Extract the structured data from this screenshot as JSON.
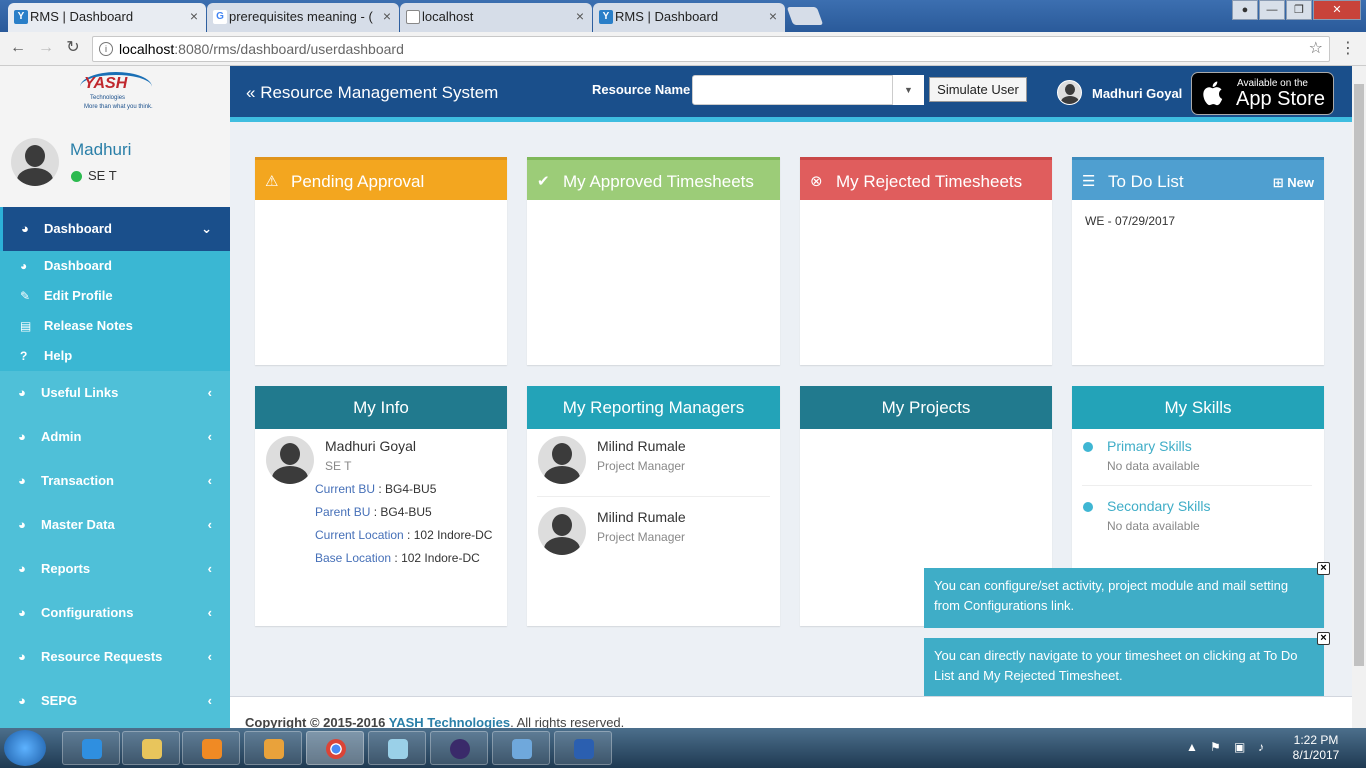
{
  "browser": {
    "tabs": [
      {
        "title": "RMS | Dashboard",
        "favicon": "Y"
      },
      {
        "title": "prerequisites meaning - (",
        "favicon": "G"
      },
      {
        "title": "localhost",
        "favicon": "doc"
      },
      {
        "title": "RMS | Dashboard",
        "favicon": "Y"
      }
    ],
    "url_host": "localhost",
    "url_path": ":8080/rms/dashboard/userdashboard"
  },
  "sidebar": {
    "logo_text": "YASH",
    "logo_sub": "Technologies",
    "logo_tagline": "More than what you think.",
    "user_name": "Madhuri",
    "user_role": "SE T",
    "active_menu": "Dashboard",
    "submenu": [
      {
        "label": "Dashboard",
        "icon": "dashboard-icon"
      },
      {
        "label": "Edit Profile",
        "icon": "pencil-icon"
      },
      {
        "label": "Release Notes",
        "icon": "note-icon"
      },
      {
        "label": "Help",
        "icon": "help-icon"
      }
    ],
    "menu": [
      {
        "label": "Useful Links"
      },
      {
        "label": "Admin"
      },
      {
        "label": "Transaction"
      },
      {
        "label": "Master Data"
      },
      {
        "label": "Reports"
      },
      {
        "label": "Configurations"
      },
      {
        "label": "Resource Requests"
      },
      {
        "label": "SEPG"
      }
    ]
  },
  "header": {
    "title": "Resource Management System",
    "resource_label": "Resource Name",
    "resource_value": "",
    "simulate_label": "Simulate User",
    "user_name": "Madhuri Goyal",
    "appstore_small": "Available on the",
    "appstore_big": "App Store"
  },
  "cards_top": {
    "pending": {
      "title": "Pending Approval",
      "color": "#f3a61f"
    },
    "approved": {
      "title": "My Approved Timesheets",
      "color": "#9ccc78"
    },
    "rejected": {
      "title": "My Rejected Timesheets",
      "color": "#e05d5d"
    },
    "todo": {
      "title": "To Do List",
      "new_label": "New",
      "color": "#4f9fd0",
      "items": [
        "WE - 07/29/2017"
      ]
    }
  },
  "my_info": {
    "title": "My Info",
    "name": "Madhuri Goyal",
    "role": "SE T",
    "fields": [
      {
        "label": "Current BU",
        "value": "BG4-BU5"
      },
      {
        "label": "Parent BU",
        "value": "BG4-BU5"
      },
      {
        "label": "Current Location",
        "value": "102 Indore-DC"
      },
      {
        "label": "Base Location",
        "value": "102 Indore-DC"
      }
    ]
  },
  "managers": {
    "title": "My Reporting Managers",
    "items": [
      {
        "name": "Milind Rumale",
        "role": "Project Manager"
      },
      {
        "name": "Milind Rumale",
        "role": "Project Manager"
      }
    ]
  },
  "projects": {
    "title": "My Projects"
  },
  "skills": {
    "title": "My Skills",
    "primary": {
      "label": "Primary Skills",
      "value": "No data available"
    },
    "secondary": {
      "label": "Secondary Skills",
      "value": "No data available"
    }
  },
  "notices": [
    "You can configure/set activity, project module and mail setting from Configurations link.",
    "You can directly navigate to your timesheet on clicking at To Do List and My Rejected Timesheet."
  ],
  "footer": {
    "copyright": "Copyright © 2015-2016 ",
    "company": "YASH Technologies",
    "rights": ". All rights reserved."
  },
  "taskbar": {
    "time": "1:22 PM",
    "date": "8/1/2017"
  }
}
